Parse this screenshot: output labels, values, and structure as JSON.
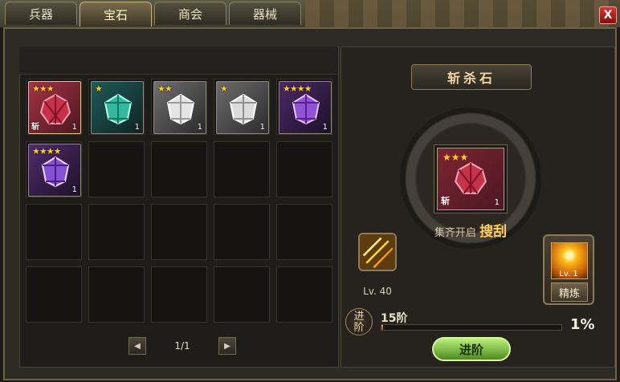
{
  "tabs": [
    {
      "label": "兵器"
    },
    {
      "label": "宝石"
    },
    {
      "label": "商会"
    },
    {
      "label": "器械"
    }
  ],
  "close_label": "X",
  "inventory": {
    "items": [
      {
        "stars": "★★★",
        "count": "1",
        "tag": "斩",
        "color": "#9d2637"
      },
      {
        "stars": "★",
        "count": "1",
        "tag": "",
        "color": "#2aa58d"
      },
      {
        "stars": "★★",
        "count": "1",
        "tag": "",
        "color": "#d4d4d4"
      },
      {
        "stars": "★",
        "count": "1",
        "tag": "",
        "color": "#cfcfcf"
      },
      {
        "stars": "★★★★",
        "count": "1",
        "tag": "",
        "color": "#8a3fd1"
      },
      {
        "stars": "★★★★",
        "count": "1",
        "tag": "",
        "color": "#7b4bd2"
      }
    ],
    "pager": {
      "text": "1/1"
    }
  },
  "detail": {
    "title": "斩杀石",
    "main_item": {
      "stars": "★★★",
      "count": "1",
      "tag": "斩"
    },
    "collect_text": "集齐开启",
    "collect_emphasis": "搜刮",
    "skill_level": "Lv. 40",
    "refine_level": "Lv. 1",
    "refine_label": "精炼",
    "stage_badge_top": "进",
    "stage_badge_bottom": "阶",
    "stage_text": "15阶",
    "stage_percent": "1%",
    "progress": 0.01,
    "advance_button": "进阶"
  }
}
